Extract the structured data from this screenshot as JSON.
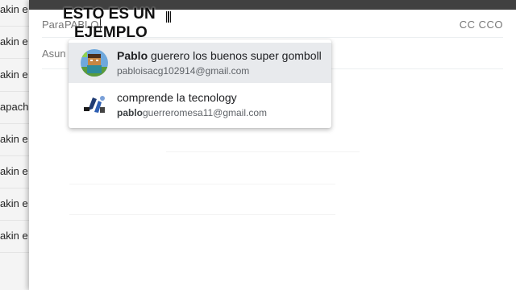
{
  "background_list": {
    "rows": [
      "akin e",
      "akin e",
      "akin e",
      "apach",
      "akin e",
      "akin e",
      "akin e",
      "akin e"
    ]
  },
  "compose": {
    "to_label": "Para",
    "to_value": "PABLO",
    "cc_label": "CC CCO",
    "subject_label": "Asunto"
  },
  "caption": {
    "line1": "ESTO ES UN",
    "line2": "EJEMPLO"
  },
  "suggestions": [
    {
      "name_bold": "Pablo",
      "name_rest": " guerero los buenos super gomboll",
      "email_bold": "",
      "email_rest": "pabloisacg102914@gmail.com",
      "avatar": "minecraft-avatar-icon"
    },
    {
      "name_bold": "",
      "name_rest": "comprende la tecnology",
      "email_bold": "pablo",
      "email_rest": "guerreromesa11@gmail.com",
      "avatar": "tech-logo-avatar-icon"
    }
  ],
  "colors": {
    "topbar": "#404040",
    "highlight": "#e8eaed",
    "label": "#777777"
  }
}
